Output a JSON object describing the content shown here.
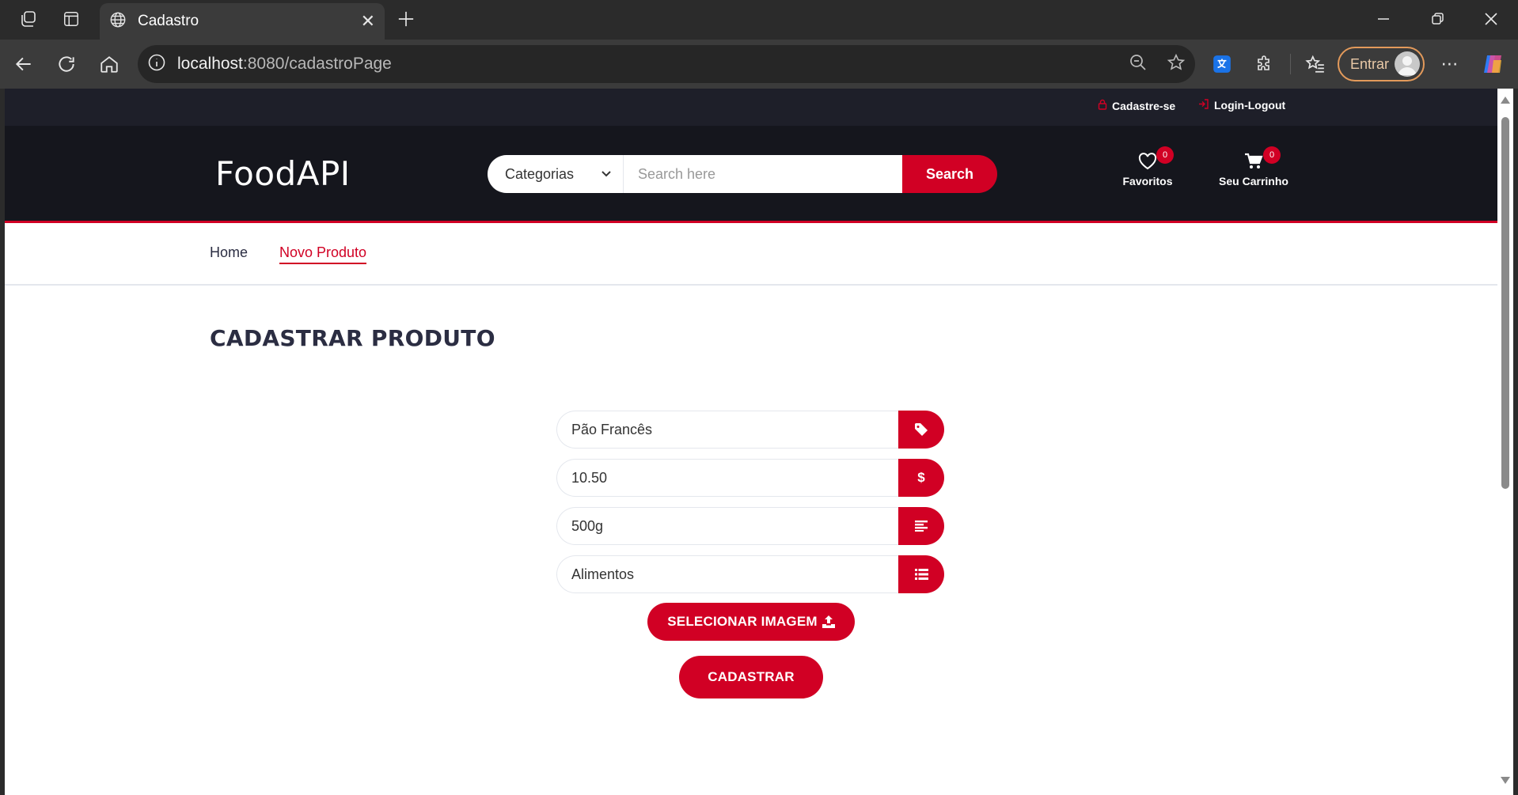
{
  "browser": {
    "tab_title": "Cadastro",
    "url_host": "localhost",
    "url_path": ":8080/cadastroPage",
    "profile_label": "Entrar"
  },
  "site": {
    "top_links": {
      "register": "Cadastre-se",
      "login": "Login-Logout"
    },
    "logo": "FoodAPI",
    "search": {
      "category_selected": "Categorias",
      "placeholder": "Search here",
      "button": "Search"
    },
    "favorites": {
      "label": "Favoritos",
      "count": "0"
    },
    "cart": {
      "label": "Seu Carrinho",
      "count": "0"
    },
    "nav": {
      "home": "Home",
      "new_product": "Novo Produto"
    }
  },
  "form": {
    "title": "CADASTRAR PRODUTO",
    "name_value": "Pão Francês",
    "price_value": "10.50",
    "description_value": "500g",
    "category_value": "Alimentos",
    "select_image_label": "SELECIONAR IMAGEM",
    "submit_label": "CADASTRAR"
  },
  "colors": {
    "accent": "#d10024",
    "header_bg": "#15161d",
    "topstrip_bg": "#1e1f29"
  },
  "icons": {
    "name": "tag-icon",
    "price": "dollar-icon",
    "description": "align-left-icon",
    "category": "list-icon",
    "upload": "upload-icon"
  }
}
